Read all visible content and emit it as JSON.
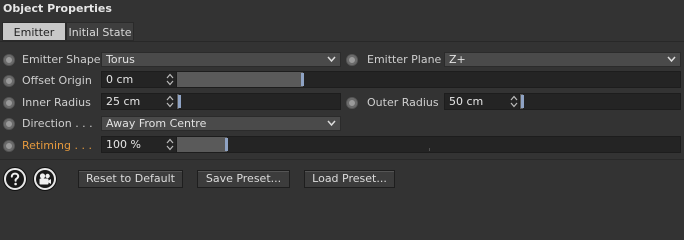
{
  "panel": {
    "title": "Object Properties"
  },
  "tabs": [
    {
      "label": "Emitter",
      "active": true
    },
    {
      "label": "Initial State",
      "active": false
    }
  ],
  "fields": {
    "emitter_shape": {
      "label": "Emitter Shape",
      "value": "Torus"
    },
    "emitter_plane": {
      "label": "Emitter Plane",
      "value": "Z+"
    },
    "offset_origin": {
      "label": "Offset Origin",
      "value": "0 cm",
      "slider_fraction": 0.25
    },
    "inner_radius": {
      "label": "Inner Radius",
      "value": "25 cm",
      "slider_fraction": 0.01
    },
    "outer_radius": {
      "label": "Outer Radius",
      "value": "50 cm",
      "slider_fraction": 0.02
    },
    "direction": {
      "label": "Direction . . .",
      "value": "Away From Centre"
    },
    "retiming": {
      "label": "Retiming . . .",
      "value": "100 %",
      "slider_fraction": 0.1
    }
  },
  "buttons": {
    "reset": "Reset to Default",
    "save": "Save Preset...",
    "load": "Load Preset..."
  },
  "icons": {
    "help": "help-icon",
    "camera": "camera-icon"
  },
  "colors": {
    "accent_label": "#e69a3e",
    "slider_handle": "#8fa3c4"
  }
}
